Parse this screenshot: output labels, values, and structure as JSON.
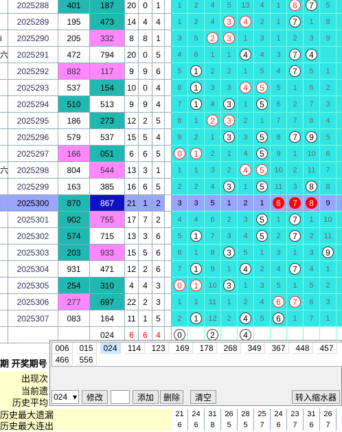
{
  "rows": [
    {
      "lead": "",
      "issue": "2025288",
      "a": "401",
      "b": "187",
      "a_bg": "teal",
      "b_bg": "teal",
      "s": [
        "20",
        "0",
        "1"
      ],
      "m": [
        {
          "t": "1"
        },
        {
          "t": "2"
        },
        {
          "t": "4"
        },
        {
          "t": "5"
        },
        {
          "t": "13"
        },
        {
          "t": "4"
        },
        {
          "t": "1"
        },
        {
          "t": "6",
          "r": "red"
        },
        {
          "t": "7",
          "r": "ring"
        },
        {
          "t": "5"
        },
        {
          "t": ""
        }
      ]
    },
    {
      "lead": "",
      "issue": "2025289",
      "a": "195",
      "b": "473",
      "a_bg": "white",
      "b_bg": "teal",
      "s": [
        "14",
        "4",
        "4"
      ],
      "m": [
        {
          "t": "1"
        },
        {
          "t": "2"
        },
        {
          "t": "4"
        },
        {
          "t": "3",
          "r": "red"
        },
        {
          "t": "4",
          "r": "red"
        },
        {
          "t": "2"
        },
        {
          "t": "1"
        },
        {
          "t": "7",
          "r": "ring"
        },
        {
          "t": "1"
        },
        {
          "t": "8"
        },
        {
          "t": ""
        }
      ]
    },
    {
      "lead": "i",
      "issue": "2025290",
      "a": "205",
      "b": "332",
      "a_bg": "white",
      "b_bg": "pink",
      "s": [
        "8",
        "8",
        "1"
      ],
      "m": [
        {
          "t": "3"
        },
        {
          "t": "5"
        },
        {
          "t": "2",
          "r": "red"
        },
        {
          "t": "3",
          "r": "red"
        },
        {
          "t": "1"
        },
        {
          "t": "3"
        },
        {
          "t": "1"
        },
        {
          "t": "2"
        },
        {
          "t": "3"
        },
        {
          "t": "9"
        },
        {
          "t": ""
        }
      ]
    },
    {
      "lead": "六",
      "issue": "2025291",
      "a": "472",
      "b": "794",
      "a_bg": "white",
      "b_bg": "white",
      "s": [
        "20",
        "0",
        "5"
      ],
      "m": [
        {
          "t": "4"
        },
        {
          "t": "6"
        },
        {
          "t": "1"
        },
        {
          "t": "1"
        },
        {
          "t": "4",
          "r": "ring"
        },
        {
          "t": "4"
        },
        {
          "t": "3"
        },
        {
          "t": "7",
          "r": "ring"
        },
        {
          "t": "4",
          "r": "ring"
        },
        {
          "t": ""
        },
        {
          "t": ""
        }
      ]
    },
    {
      "lead": "",
      "issue": "2025292",
      "a": "882",
      "b": "117",
      "a_bg": "pink",
      "b_bg": "pink",
      "s": [
        "9",
        "9",
        "6"
      ],
      "m": [
        {
          "t": "5"
        },
        {
          "t": "1",
          "r": "ring"
        },
        {
          "t": "2"
        },
        {
          "t": "2"
        },
        {
          "t": "1"
        },
        {
          "t": "5"
        },
        {
          "t": "4"
        },
        {
          "t": "7",
          "r": "ring"
        },
        {
          "t": "5"
        },
        {
          "t": "1"
        },
        {
          "t": ""
        }
      ]
    },
    {
      "lead": "",
      "issue": "2025293",
      "a": "537",
      "b": "154",
      "a_bg": "white",
      "b_bg": "teal",
      "s": [
        "10",
        "0",
        "4"
      ],
      "m": [
        {
          "t": "6"
        },
        {
          "t": "1",
          "r": "ring"
        },
        {
          "t": "3"
        },
        {
          "t": "3"
        },
        {
          "t": "4",
          "r": "red"
        },
        {
          "t": "5",
          "r": "red"
        },
        {
          "t": "5"
        },
        {
          "t": "1"
        },
        {
          "t": "6"
        },
        {
          "t": "2"
        },
        {
          "t": ""
        }
      ]
    },
    {
      "lead": "",
      "issue": "2025294",
      "a": "510",
      "b": "513",
      "a_bg": "teal",
      "b_bg": "white",
      "s": [
        "9",
        "9",
        "4"
      ],
      "m": [
        {
          "t": "7"
        },
        {
          "t": "1",
          "r": "ring"
        },
        {
          "t": "4"
        },
        {
          "t": "3",
          "r": "ring"
        },
        {
          "t": "1"
        },
        {
          "t": "5",
          "r": "ring"
        },
        {
          "t": "6"
        },
        {
          "t": "2"
        },
        {
          "t": "7"
        },
        {
          "t": "3"
        },
        {
          "t": ""
        }
      ]
    },
    {
      "lead": "",
      "issue": "2025295",
      "a": "186",
      "b": "273",
      "a_bg": "white",
      "b_bg": "teal",
      "s": [
        "12",
        "2",
        "5"
      ],
      "m": [
        {
          "t": "8"
        },
        {
          "t": "1"
        },
        {
          "t": "2",
          "r": "red"
        },
        {
          "t": "3",
          "r": "red"
        },
        {
          "t": "2"
        },
        {
          "t": "1"
        },
        {
          "t": "7"
        },
        {
          "t": "7"
        },
        {
          "t": "8"
        },
        {
          "t": "4"
        },
        {
          "t": ""
        }
      ]
    },
    {
      "lead": "",
      "issue": "2025296",
      "a": "579",
      "b": "537",
      "a_bg": "white",
      "b_bg": "white",
      "s": [
        "15",
        "5",
        "4"
      ],
      "m": [
        {
          "t": "9"
        },
        {
          "t": "2"
        },
        {
          "t": "1"
        },
        {
          "t": "3",
          "r": "ring"
        },
        {
          "t": "3"
        },
        {
          "t": "5",
          "r": "ring"
        },
        {
          "t": "8"
        },
        {
          "t": "7",
          "r": "ring"
        },
        {
          "t": "9",
          "r": "ring"
        },
        {
          "t": "5"
        },
        {
          "t": ""
        }
      ]
    },
    {
      "lead": "",
      "issue": "2025297",
      "a": "166",
      "b": "051",
      "a_bg": "pink",
      "b_bg": "teal",
      "s": [
        "6",
        "6",
        "5"
      ],
      "m": [
        {
          "t": "0",
          "r": "red"
        },
        {
          "t": "1",
          "r": "red"
        },
        {
          "t": "2"
        },
        {
          "t": "1"
        },
        {
          "t": "4"
        },
        {
          "t": "5",
          "r": "ring"
        },
        {
          "t": "9"
        },
        {
          "t": "1"
        },
        {
          "t": "10"
        },
        {
          "t": "6"
        },
        {
          "t": ""
        }
      ]
    },
    {
      "lead": "六",
      "issue": "2025298",
      "a": "804",
      "b": "544",
      "a_bg": "white",
      "b_bg": "pink",
      "s": [
        "13",
        "3",
        "1"
      ],
      "m": [
        {
          "t": "1"
        },
        {
          "t": "1"
        },
        {
          "t": "3"
        },
        {
          "t": "2"
        },
        {
          "t": "4",
          "r": "red"
        },
        {
          "t": "5",
          "r": "red"
        },
        {
          "t": "10"
        },
        {
          "t": "2"
        },
        {
          "t": "11"
        },
        {
          "t": "7"
        },
        {
          "t": ""
        }
      ]
    },
    {
      "lead": "",
      "issue": "2025299",
      "a": "163",
      "b": "385",
      "a_bg": "white",
      "b_bg": "white",
      "s": [
        "16",
        "6",
        "5"
      ],
      "m": [
        {
          "t": "2"
        },
        {
          "t": "2"
        },
        {
          "t": "4"
        },
        {
          "t": "3",
          "r": "ring"
        },
        {
          "t": "1"
        },
        {
          "t": "5",
          "r": "ring"
        },
        {
          "t": "11"
        },
        {
          "t": "3"
        },
        {
          "t": "8",
          "r": "ring"
        },
        {
          "t": "8"
        },
        {
          "t": ""
        }
      ]
    },
    {
      "lead": "",
      "issue": "2025300",
      "a": "870",
      "b": "867",
      "sel": true,
      "s": [
        "21",
        "1",
        "2"
      ],
      "m": [
        {
          "t": "3"
        },
        {
          "t": "3"
        },
        {
          "t": "5"
        },
        {
          "t": "1"
        },
        {
          "t": "2"
        },
        {
          "t": "1"
        },
        {
          "t": "6",
          "r": "fill"
        },
        {
          "t": "7",
          "r": "fill"
        },
        {
          "t": "8",
          "r": "fill"
        },
        {
          "t": "9"
        },
        {
          "t": ""
        }
      ]
    },
    {
      "lead": "",
      "issue": "2025301",
      "a": "902",
      "b": "755",
      "a_bg": "teal",
      "b_bg": "pink",
      "s": [
        "17",
        "7",
        "2"
      ],
      "m": [
        {
          "t": "4"
        },
        {
          "t": "4"
        },
        {
          "t": "6"
        },
        {
          "t": "2"
        },
        {
          "t": "3"
        },
        {
          "t": "5",
          "r": "ring"
        },
        {
          "t": "1"
        },
        {
          "t": "7",
          "r": "ring"
        },
        {
          "t": "1"
        },
        {
          "t": "10"
        },
        {
          "t": ""
        }
      ]
    },
    {
      "lead": "",
      "issue": "2025302",
      "a": "574",
      "b": "715",
      "a_bg": "teal",
      "b_bg": "white",
      "s": [
        "13",
        "3",
        "6"
      ],
      "m": [
        {
          "t": "5"
        },
        {
          "t": "1",
          "r": "ring"
        },
        {
          "t": "7"
        },
        {
          "t": "3"
        },
        {
          "t": "4"
        },
        {
          "t": "5",
          "r": "ring"
        },
        {
          "t": "2"
        },
        {
          "t": "7",
          "r": "ring"
        },
        {
          "t": "2"
        },
        {
          "t": "11"
        },
        {
          "t": ""
        }
      ]
    },
    {
      "lead": "",
      "issue": "2025303",
      "a": "203",
      "b": "933",
      "a_bg": "teal",
      "b_bg": "pink",
      "s": [
        "15",
        "5",
        "6"
      ],
      "m": [
        {
          "t": "6"
        },
        {
          "t": "1"
        },
        {
          "t": "8"
        },
        {
          "t": "3",
          "r": "ring"
        },
        {
          "t": "5"
        },
        {
          "t": "1"
        },
        {
          "t": "3"
        },
        {
          "t": "1"
        },
        {
          "t": "3"
        },
        {
          "t": "9",
          "r": "ring"
        },
        {
          "t": ""
        }
      ]
    },
    {
      "lead": "",
      "issue": "2025304",
      "a": "931",
      "b": "471",
      "a_bg": "white",
      "b_bg": "white",
      "s": [
        "12",
        "2",
        "6"
      ],
      "m": [
        {
          "t": "7"
        },
        {
          "t": "1",
          "r": "ring"
        },
        {
          "t": "9"
        },
        {
          "t": "1"
        },
        {
          "t": "4",
          "r": "ring"
        },
        {
          "t": "2"
        },
        {
          "t": "4"
        },
        {
          "t": "7",
          "r": "ring"
        },
        {
          "t": "4"
        },
        {
          "t": "1"
        },
        {
          "t": ""
        }
      ]
    },
    {
      "lead": "",
      "issue": "2025305",
      "a": "254",
      "b": "310",
      "a_bg": "teal",
      "b_bg": "teal",
      "s": [
        "4",
        "4",
        "3"
      ],
      "m": [
        {
          "t": "0",
          "r": "red"
        },
        {
          "t": "1",
          "r": "red"
        },
        {
          "t": "10"
        },
        {
          "t": "3",
          "r": "ring"
        },
        {
          "t": "1"
        },
        {
          "t": "3"
        },
        {
          "t": "5"
        },
        {
          "t": "1"
        },
        {
          "t": "5"
        },
        {
          "t": "2"
        },
        {
          "t": ""
        }
      ]
    },
    {
      "lead": "",
      "issue": "2025306",
      "a": "277",
      "b": "697",
      "a_bg": "pink",
      "b_bg": "teal",
      "s": [
        "22",
        "2",
        "3"
      ],
      "m": [
        {
          "t": "1"
        },
        {
          "t": "1"
        },
        {
          "t": "11"
        },
        {
          "t": "1"
        },
        {
          "t": "2"
        },
        {
          "t": "4"
        },
        {
          "t": "6",
          "r": "red"
        },
        {
          "t": "7",
          "r": "red"
        },
        {
          "t": "6"
        },
        {
          "t": "3"
        },
        {
          "t": ""
        }
      ]
    },
    {
      "lead": "",
      "issue": "2025307",
      "a": "083",
      "b": "164",
      "a_bg": "white",
      "b_bg": "white",
      "s": [
        "11",
        "1",
        "5"
      ],
      "m": [
        {
          "t": "2"
        },
        {
          "t": "1",
          "r": "ring"
        },
        {
          "t": "12"
        },
        {
          "t": "2"
        },
        {
          "t": "4",
          "r": "ring"
        },
        {
          "t": "5"
        },
        {
          "t": "6",
          "r": "ring"
        },
        {
          "t": "1"
        },
        {
          "t": "7"
        },
        {
          "t": "1"
        },
        {
          "t": ""
        }
      ]
    }
  ],
  "summary": {
    "b": "024",
    "s": [
      "6",
      "6",
      "4"
    ],
    "m": [
      {
        "t": "0",
        "r": "ring"
      },
      {
        "t": ""
      },
      {
        "t": "2",
        "r": "ring"
      },
      {
        "t": ""
      },
      {
        "t": "4",
        "r": "ring"
      },
      {
        "t": ""
      },
      {
        "t": ""
      },
      {
        "t": ""
      },
      {
        "t": ""
      },
      {
        "t": ""
      },
      {
        "t": ""
      }
    ]
  },
  "left_labels": {
    "header": "期 开奖期号",
    "l1": "出现次",
    "l2": "当前遗",
    "l3": "历史平均"
  },
  "panel": {
    "chips_row1": [
      "006",
      "015",
      "024",
      "114",
      "123",
      "169",
      "178",
      "268",
      "349",
      "367",
      "448",
      "457"
    ],
    "chips_row2": [
      "466",
      "556"
    ],
    "active_chip": "024",
    "select_value": "024",
    "btn_edit": "修改",
    "btn_add": "添加",
    "btn_delete": "删除",
    "btn_clear": "清空",
    "btn_shrink": "转入缩水器"
  },
  "stats": [
    {
      "label": "历史最大遗漏",
      "values": [
        "21",
        "24",
        "31",
        "26",
        "28",
        "25",
        "24",
        "23",
        "31",
        "26",
        "2"
      ]
    },
    {
      "label": "历史最大连出",
      "values": [
        "6",
        "6",
        "8",
        "5",
        "5",
        "7",
        "6",
        "7",
        "6",
        "7",
        "5"
      ]
    }
  ],
  "colors": {
    "teal": "#20b8b0",
    "pink": "#ff88ff",
    "cyan": "#33e6e6",
    "selected_row": "#9aa5ff",
    "selected_cell": "#1010c8",
    "hot": "#ff0000"
  }
}
